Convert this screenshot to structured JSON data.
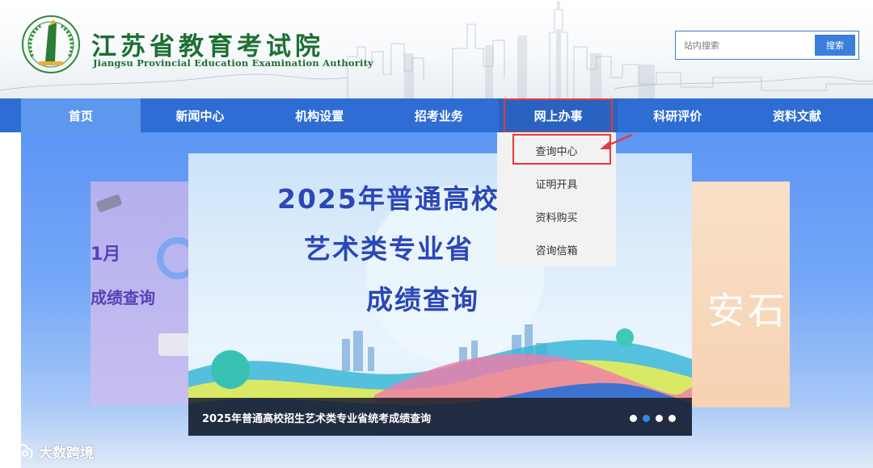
{
  "header": {
    "title": "江苏省教育考试院",
    "subtitle": "Jiangsu Provincial Education Examination Authority",
    "search": {
      "placeholder": "站内搜索",
      "button_label": "搜索"
    }
  },
  "nav": {
    "items": [
      {
        "label": "首页"
      },
      {
        "label": "新闻中心"
      },
      {
        "label": "机构设置"
      },
      {
        "label": "招考业务"
      },
      {
        "label": "网上办事"
      },
      {
        "label": "科研评价"
      },
      {
        "label": "资料文献"
      }
    ]
  },
  "dropdown": {
    "items": [
      {
        "label": "查询中心"
      },
      {
        "label": "证明开具"
      },
      {
        "label": "资料购买"
      },
      {
        "label": "咨询信箱"
      }
    ]
  },
  "banner": {
    "line1": "2025年普通高校",
    "line2": "艺术类专业省",
    "line3": "成绩查询",
    "caption": "2025年普通高校招生艺术类专业省统考成绩查询",
    "left_card": {
      "line1": "1月",
      "line2": "成绩查询"
    },
    "right_card": {
      "text": "安石"
    },
    "dots_total": 4,
    "active_dot": 1
  },
  "watermark": {
    "text": "大数跨境"
  },
  "colors": {
    "nav": "#2e6dd3",
    "nav_active": "#5e97ee",
    "highlight": "#e33b3b",
    "title_green": "#1c6f32"
  }
}
